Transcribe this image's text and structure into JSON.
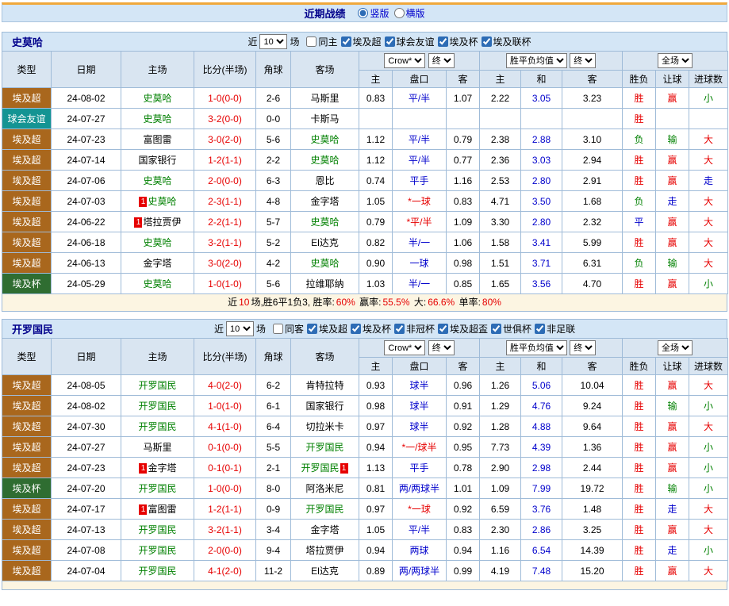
{
  "misc": {
    "red_card_label": "1"
  },
  "topbar": {
    "title": "近期战绩",
    "layout_options": [
      {
        "label": "竖版",
        "selected": true
      },
      {
        "label": "横版",
        "selected": false
      }
    ]
  },
  "sections": [
    {
      "team": "史莫哈",
      "filter": {
        "near_label": "近",
        "count": "10",
        "games_label": "场",
        "checkboxes": [
          {
            "label": "同主",
            "checked": false
          },
          {
            "label": "埃及超",
            "checked": true
          },
          {
            "label": "球会友谊",
            "checked": true
          },
          {
            "label": "埃及杯",
            "checked": true
          },
          {
            "label": "埃及联杯",
            "checked": true
          }
        ]
      },
      "header": {
        "cols": [
          "类型",
          "日期",
          "主场",
          "比分(半场)",
          "角球",
          "客场"
        ],
        "odds_company": "Crow*",
        "odds_state": "终",
        "avg_label": "胜平负均值",
        "avg_state": "终",
        "scope": "全场",
        "sub": [
          "主",
          "盘口",
          "客",
          "主",
          "和",
          "客",
          "胜负",
          "让球",
          "进球数"
        ]
      },
      "rows": [
        {
          "type": "埃及超",
          "tc": "super",
          "date": "24-08-02",
          "home": "史莫哈",
          "hf": true,
          "hb": "",
          "score": "1-0(0-0)",
          "corner": "2-6",
          "away": "马斯里",
          "af": false,
          "ab": "",
          "oh": "0.83",
          "hc": "平/半",
          "hcr": false,
          "oa": "1.07",
          "ah": "2.22",
          "ad": "3.05",
          "aa": "3.23",
          "res": "胜",
          "resc": "r",
          "lr": "赢",
          "lrc": "r",
          "gr": "小",
          "grc": "g"
        },
        {
          "type": "球会友谊",
          "tc": "friendly",
          "date": "24-07-27",
          "home": "史莫哈",
          "hf": true,
          "hb": "",
          "score": "3-2(0-0)",
          "corner": "0-0",
          "away": "卡斯马",
          "af": false,
          "ab": "",
          "oh": "",
          "hc": "",
          "hcr": false,
          "oa": "",
          "ah": "",
          "ad": "",
          "aa": "",
          "res": "胜",
          "resc": "r",
          "lr": "",
          "lrc": "k",
          "gr": "",
          "grc": "k"
        },
        {
          "type": "埃及超",
          "tc": "super",
          "date": "24-07-23",
          "home": "富图雷",
          "hf": false,
          "hb": "",
          "score": "3-0(2-0)",
          "corner": "5-6",
          "away": "史莫哈",
          "af": true,
          "ab": "",
          "oh": "1.12",
          "hc": "平/半",
          "hcr": false,
          "oa": "0.79",
          "ah": "2.38",
          "ad": "2.88",
          "aa": "3.10",
          "res": "负",
          "resc": "g",
          "lr": "输",
          "lrc": "g",
          "gr": "大",
          "grc": "r"
        },
        {
          "type": "埃及超",
          "tc": "super",
          "date": "24-07-14",
          "home": "国家银行",
          "hf": false,
          "hb": "",
          "score": "1-2(1-1)",
          "corner": "2-2",
          "away": "史莫哈",
          "af": true,
          "ab": "",
          "oh": "1.12",
          "hc": "平/半",
          "hcr": false,
          "oa": "0.77",
          "ah": "2.36",
          "ad": "3.03",
          "aa": "2.94",
          "res": "胜",
          "resc": "r",
          "lr": "赢",
          "lrc": "r",
          "gr": "大",
          "grc": "r"
        },
        {
          "type": "埃及超",
          "tc": "super",
          "date": "24-07-06",
          "home": "史莫哈",
          "hf": true,
          "hb": "",
          "score": "2-0(0-0)",
          "corner": "6-3",
          "away": "恩比",
          "af": false,
          "ab": "",
          "oh": "0.74",
          "hc": "平手",
          "hcr": false,
          "oa": "1.16",
          "ah": "2.53",
          "ad": "2.80",
          "aa": "2.91",
          "res": "胜",
          "resc": "r",
          "lr": "赢",
          "lrc": "r",
          "gr": "走",
          "grc": "b"
        },
        {
          "type": "埃及超",
          "tc": "super",
          "date": "24-07-03",
          "home": "史莫哈",
          "hf": true,
          "hb": "pre",
          "score": "2-3(1-1)",
          "corner": "4-8",
          "away": "金字塔",
          "af": false,
          "ab": "",
          "oh": "1.05",
          "hc": "*一球",
          "hcr": true,
          "oa": "0.83",
          "ah": "4.71",
          "ad": "3.50",
          "aa": "1.68",
          "res": "负",
          "resc": "g",
          "lr": "走",
          "lrc": "b",
          "gr": "大",
          "grc": "r"
        },
        {
          "type": "埃及超",
          "tc": "super",
          "date": "24-06-22",
          "home": "塔拉贾伊",
          "hf": false,
          "hb": "pre",
          "score": "2-2(1-1)",
          "corner": "5-7",
          "away": "史莫哈",
          "af": true,
          "ab": "",
          "oh": "0.79",
          "hc": "*平/半",
          "hcr": true,
          "oa": "1.09",
          "ah": "3.30",
          "ad": "2.80",
          "aa": "2.32",
          "res": "平",
          "resc": "b",
          "lr": "赢",
          "lrc": "r",
          "gr": "大",
          "grc": "r"
        },
        {
          "type": "埃及超",
          "tc": "super",
          "date": "24-06-18",
          "home": "史莫哈",
          "hf": true,
          "hb": "",
          "score": "3-2(1-1)",
          "corner": "5-2",
          "away": "El达克",
          "af": false,
          "ab": "",
          "oh": "0.82",
          "hc": "半/一",
          "hcr": false,
          "oa": "1.06",
          "ah": "1.58",
          "ad": "3.41",
          "aa": "5.99",
          "res": "胜",
          "resc": "r",
          "lr": "赢",
          "lrc": "r",
          "gr": "大",
          "grc": "r"
        },
        {
          "type": "埃及超",
          "tc": "super",
          "date": "24-06-13",
          "home": "金字塔",
          "hf": false,
          "hb": "",
          "score": "3-0(2-0)",
          "corner": "4-2",
          "away": "史莫哈",
          "af": true,
          "ab": "",
          "oh": "0.90",
          "hc": "一球",
          "hcr": false,
          "oa": "0.98",
          "ah": "1.51",
          "ad": "3.71",
          "aa": "6.31",
          "res": "负",
          "resc": "g",
          "lr": "输",
          "lrc": "g",
          "gr": "大",
          "grc": "r"
        },
        {
          "type": "埃及杯",
          "tc": "cup",
          "date": "24-05-29",
          "home": "史莫哈",
          "hf": true,
          "hb": "",
          "score": "1-0(1-0)",
          "corner": "5-6",
          "away": "拉维耶纳",
          "af": false,
          "ab": "",
          "oh": "1.03",
          "hc": "半/一",
          "hcr": false,
          "oa": "0.85",
          "ah": "1.65",
          "ad": "3.56",
          "aa": "4.70",
          "res": "胜",
          "resc": "r",
          "lr": "赢",
          "lrc": "r",
          "gr": "小",
          "grc": "g"
        }
      ],
      "summary": [
        {
          "t": "近",
          "c": "k"
        },
        {
          "t": "10",
          "c": "r"
        },
        {
          "t": "场,胜6平1负3, 胜率:",
          "c": "k"
        },
        {
          "t": "60%",
          "c": "r"
        },
        {
          "t": " 赢率:",
          "c": "k"
        },
        {
          "t": "55.5%",
          "c": "r"
        },
        {
          "t": " 大:",
          "c": "k"
        },
        {
          "t": "66.6%",
          "c": "r"
        },
        {
          "t": " 单率:",
          "c": "k"
        },
        {
          "t": "80%",
          "c": "r"
        }
      ]
    },
    {
      "team": "开罗国民",
      "filter": {
        "near_label": "近",
        "count": "10",
        "games_label": "场",
        "checkboxes": [
          {
            "label": "同客",
            "checked": false
          },
          {
            "label": "埃及超",
            "checked": true
          },
          {
            "label": "埃及杯",
            "checked": true
          },
          {
            "label": "非冠杯",
            "checked": true
          },
          {
            "label": "埃及超盃",
            "checked": true
          },
          {
            "label": "世俱杯",
            "checked": true
          },
          {
            "label": "非足联",
            "checked": true
          }
        ]
      },
      "header": {
        "cols": [
          "类型",
          "日期",
          "主场",
          "比分(半场)",
          "角球",
          "客场"
        ],
        "odds_company": "Crow*",
        "odds_state": "终",
        "avg_label": "胜平负均值",
        "avg_state": "终",
        "scope": "全场",
        "sub": [
          "主",
          "盘口",
          "客",
          "主",
          "和",
          "客",
          "胜负",
          "让球",
          "进球数"
        ]
      },
      "rows": [
        {
          "type": "埃及超",
          "tc": "super",
          "date": "24-08-05",
          "home": "开罗国民",
          "hf": true,
          "hb": "",
          "score": "4-0(2-0)",
          "corner": "6-2",
          "away": "肯特拉特",
          "af": false,
          "ab": "",
          "oh": "0.93",
          "hc": "球半",
          "hcr": false,
          "oa": "0.96",
          "ah": "1.26",
          "ad": "5.06",
          "aa": "10.04",
          "res": "胜",
          "resc": "r",
          "lr": "赢",
          "lrc": "r",
          "gr": "大",
          "grc": "r"
        },
        {
          "type": "埃及超",
          "tc": "super",
          "date": "24-08-02",
          "home": "开罗国民",
          "hf": true,
          "hb": "",
          "score": "1-0(1-0)",
          "corner": "6-1",
          "away": "国家银行",
          "af": false,
          "ab": "",
          "oh": "0.98",
          "hc": "球半",
          "hcr": false,
          "oa": "0.91",
          "ah": "1.29",
          "ad": "4.76",
          "aa": "9.24",
          "res": "胜",
          "resc": "r",
          "lr": "输",
          "lrc": "g",
          "gr": "小",
          "grc": "g"
        },
        {
          "type": "埃及超",
          "tc": "super",
          "date": "24-07-30",
          "home": "开罗国民",
          "hf": true,
          "hb": "",
          "score": "4-1(1-0)",
          "corner": "6-4",
          "away": "切拉米卡",
          "af": false,
          "ab": "",
          "oh": "0.97",
          "hc": "球半",
          "hcr": false,
          "oa": "0.92",
          "ah": "1.28",
          "ad": "4.88",
          "aa": "9.64",
          "res": "胜",
          "resc": "r",
          "lr": "赢",
          "lrc": "r",
          "gr": "大",
          "grc": "r"
        },
        {
          "type": "埃及超",
          "tc": "super",
          "date": "24-07-27",
          "home": "马斯里",
          "hf": false,
          "hb": "",
          "score": "0-1(0-0)",
          "corner": "5-5",
          "away": "开罗国民",
          "af": true,
          "ab": "",
          "oh": "0.94",
          "hc": "*一/球半",
          "hcr": true,
          "oa": "0.95",
          "ah": "7.73",
          "ad": "4.39",
          "aa": "1.36",
          "res": "胜",
          "resc": "r",
          "lr": "赢",
          "lrc": "r",
          "gr": "小",
          "grc": "g"
        },
        {
          "type": "埃及超",
          "tc": "super",
          "date": "24-07-23",
          "home": "金字塔",
          "hf": false,
          "hb": "pre",
          "score": "0-1(0-1)",
          "corner": "2-1",
          "away": "开罗国民",
          "af": true,
          "ab": "post",
          "oh": "1.13",
          "hc": "平手",
          "hcr": false,
          "oa": "0.78",
          "ah": "2.90",
          "ad": "2.98",
          "aa": "2.44",
          "res": "胜",
          "resc": "r",
          "lr": "赢",
          "lrc": "r",
          "gr": "小",
          "grc": "g"
        },
        {
          "type": "埃及杯",
          "tc": "cup",
          "date": "24-07-20",
          "home": "开罗国民",
          "hf": true,
          "hb": "",
          "score": "1-0(0-0)",
          "corner": "8-0",
          "away": "阿洛米尼",
          "af": false,
          "ab": "",
          "oh": "0.81",
          "hc": "两/两球半",
          "hcr": false,
          "oa": "1.01",
          "ah": "1.09",
          "ad": "7.99",
          "aa": "19.72",
          "res": "胜",
          "resc": "r",
          "lr": "输",
          "lrc": "g",
          "gr": "小",
          "grc": "g"
        },
        {
          "type": "埃及超",
          "tc": "super",
          "date": "24-07-17",
          "home": "富图雷",
          "hf": false,
          "hb": "pre",
          "score": "1-2(1-1)",
          "corner": "0-9",
          "away": "开罗国民",
          "af": true,
          "ab": "",
          "oh": "0.97",
          "hc": "*一球",
          "hcr": true,
          "oa": "0.92",
          "ah": "6.59",
          "ad": "3.76",
          "aa": "1.48",
          "res": "胜",
          "resc": "r",
          "lr": "走",
          "lrc": "b",
          "gr": "大",
          "grc": "r"
        },
        {
          "type": "埃及超",
          "tc": "super",
          "date": "24-07-13",
          "home": "开罗国民",
          "hf": true,
          "hb": "",
          "score": "3-2(1-1)",
          "corner": "3-4",
          "away": "金字塔",
          "af": false,
          "ab": "",
          "oh": "1.05",
          "hc": "平/半",
          "hcr": false,
          "oa": "0.83",
          "ah": "2.30",
          "ad": "2.86",
          "aa": "3.25",
          "res": "胜",
          "resc": "r",
          "lr": "赢",
          "lrc": "r",
          "gr": "大",
          "grc": "r"
        },
        {
          "type": "埃及超",
          "tc": "super",
          "date": "24-07-08",
          "home": "开罗国民",
          "hf": true,
          "hb": "",
          "score": "2-0(0-0)",
          "corner": "9-4",
          "away": "塔拉贾伊",
          "af": false,
          "ab": "",
          "oh": "0.94",
          "hc": "两球",
          "hcr": false,
          "oa": "0.94",
          "ah": "1.16",
          "ad": "6.54",
          "aa": "14.39",
          "res": "胜",
          "resc": "r",
          "lr": "走",
          "lrc": "b",
          "gr": "小",
          "grc": "g"
        },
        {
          "type": "埃及超",
          "tc": "super",
          "date": "24-07-04",
          "home": "开罗国民",
          "hf": true,
          "hb": "",
          "score": "4-1(2-0)",
          "corner": "11-2",
          "away": "El达克",
          "af": false,
          "ab": "",
          "oh": "0.89",
          "hc": "两/两球半",
          "hcr": false,
          "oa": "0.99",
          "ah": "4.19",
          "ad": "7.48",
          "aa": "15.20",
          "res": "胜",
          "resc": "r",
          "lr": "赢",
          "lrc": "r",
          "gr": "大",
          "grc": "r"
        }
      ],
      "summary": []
    }
  ]
}
